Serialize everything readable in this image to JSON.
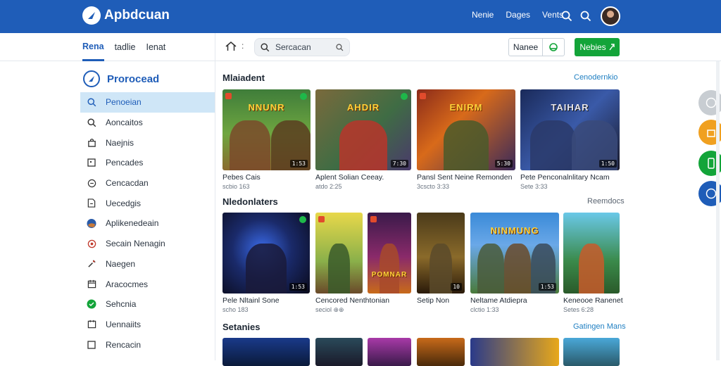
{
  "app": {
    "title": "Apbdcuan"
  },
  "header": {
    "nav": [
      "Nenie",
      "Dages",
      "Vents"
    ]
  },
  "subbar": {
    "tabs": [
      "Rena",
      "tadlie",
      "Ienat"
    ],
    "colon": ":",
    "search_label": "Sercacan",
    "outline_button": "Nanee",
    "green_button": "Nebies"
  },
  "sidebar": {
    "heading": "Prorocead",
    "items": [
      {
        "label": "Penoeian",
        "icon": "search-icon"
      },
      {
        "label": "Aoncaitos",
        "icon": "search-icon"
      },
      {
        "label": "Naejnis",
        "icon": "bag-icon"
      },
      {
        "label": "Pencades",
        "icon": "square-icon"
      },
      {
        "label": "Cencacdan",
        "icon": "chat-icon"
      },
      {
        "label": "Uecedgis",
        "icon": "doc-icon"
      },
      {
        "label": "Aplikenedeain",
        "icon": "globe-icon"
      },
      {
        "label": "Secain Nenagin",
        "icon": "target-icon"
      },
      {
        "label": "Naegen",
        "icon": "tools-icon"
      },
      {
        "label": "Aracocmes",
        "icon": "calendar-icon"
      },
      {
        "label": "Sehcnia",
        "icon": "green-badge-icon"
      },
      {
        "label": "Uennaiits",
        "icon": "calendar-icon"
      },
      {
        "label": "Rencacin",
        "icon": "square-icon"
      }
    ]
  },
  "sections": [
    {
      "title": "Mlaiadent",
      "link": "Cenodernkio",
      "cards": [
        {
          "caption": "Pebes Cais",
          "sub": "scbio 163",
          "badge": "1:53",
          "art": "NNUNR"
        },
        {
          "caption": "Aplent Solian Ceeay.",
          "sub": "atdo 2:25",
          "badge": "7:30",
          "art": "AHDIR"
        },
        {
          "caption": "Pansl Sent Neine Remonden",
          "sub": "3cscto 3:33",
          "badge": "5:30",
          "art": "ENIRM"
        },
        {
          "caption": "Pete Penconalnlitary Ncam",
          "sub": "Sete 3:33",
          "badge": "1:50",
          "art": "TAIHAR"
        }
      ]
    },
    {
      "title": "Nledonlaters",
      "link": "Reemdocs",
      "cards": [
        {
          "caption": "Pele Nltainl Sone",
          "sub": "scho 183",
          "badge": "1:53",
          "art": ""
        },
        {
          "caption": "Cencored Nenthtonian",
          "sub": "seciol ⊕⊕",
          "badge": "",
          "art": ""
        },
        {
          "caption": "",
          "sub": "",
          "badge": "",
          "art": "POMNAR"
        },
        {
          "caption": "Setip Non",
          "sub": "",
          "badge": "10",
          "art": ""
        },
        {
          "caption": "Neltame Atdiepra",
          "sub": "clctio 1:33",
          "badge": "1:53",
          "art": "NINMUNG"
        },
        {
          "caption": "Keneooe Ranenet",
          "sub": "Setes 6:28",
          "badge": "",
          "art": ""
        }
      ]
    },
    {
      "title": "Setanies",
      "link": "Gatingen Mans"
    }
  ],
  "colors": {
    "brand": "#1f5db8",
    "green": "#13a439",
    "active_bg": "#cfe6f7"
  }
}
